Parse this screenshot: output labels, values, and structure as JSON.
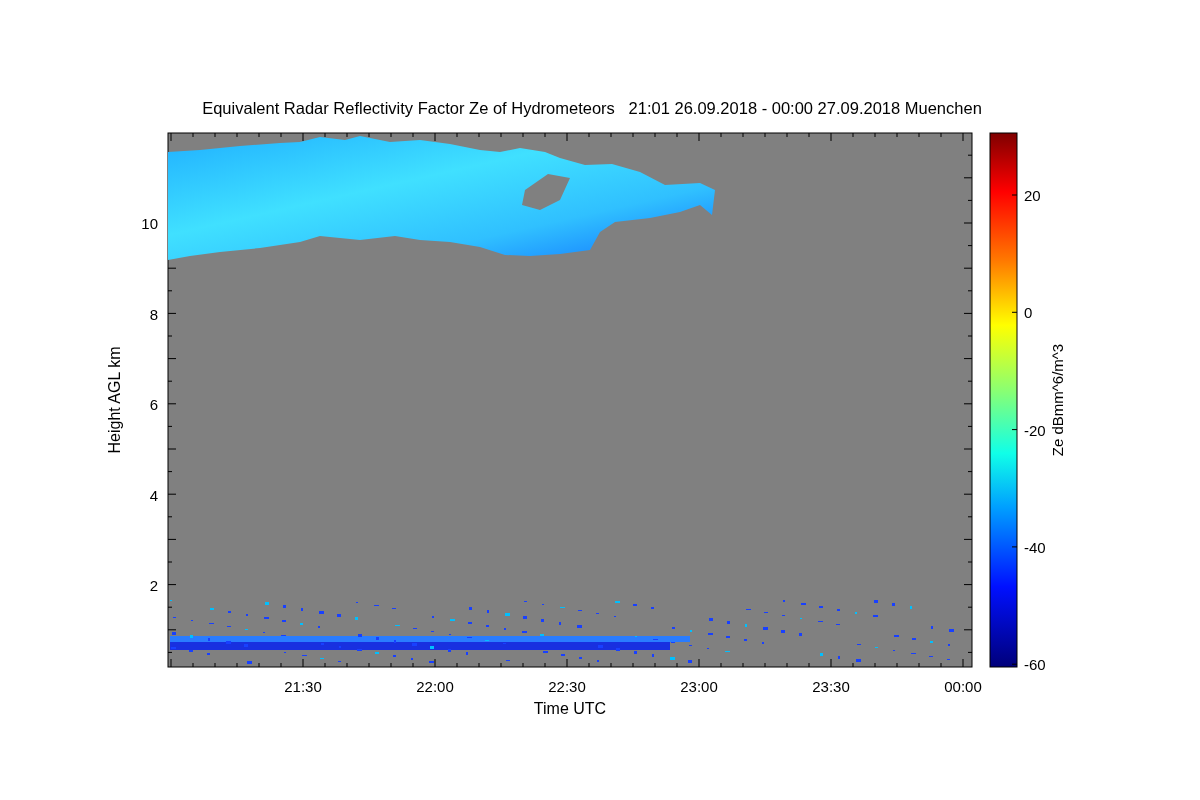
{
  "title": "Equivalent Radar Reflectivity Factor Ze of Hydrometeors   21:01 26.09.2018 - 00:00 27.09.2018 Muenchen",
  "y_axis": {
    "label": "Height AGL km",
    "ticks": [
      "10",
      "8",
      "6",
      "4",
      "2"
    ]
  },
  "x_axis": {
    "label": "Time UTC",
    "ticks": [
      "21:30",
      "22:00",
      "22:30",
      "23:00",
      "23:30",
      "00:00"
    ]
  },
  "colorbar": {
    "label": "Ze dBmm^6/m^3",
    "ticks": [
      "20",
      "0",
      "-20",
      "-40",
      "-60"
    ]
  }
}
